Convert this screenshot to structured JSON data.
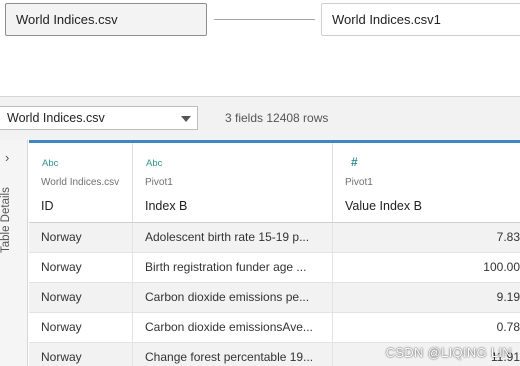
{
  "canvas": {
    "primary_table": "World Indices.csv",
    "secondary_table": "World Indices.csv1"
  },
  "toolbar": {
    "table_select_value": "World Indices.csv",
    "fields_info": "3 fields 12408 rows"
  },
  "rail": {
    "label": "Table Details"
  },
  "grid": {
    "columns": [
      {
        "type_label": "Abc",
        "source": "World Indices.csv",
        "name": "ID"
      },
      {
        "type_label": "Abc",
        "source": "Pivot1",
        "name": "Index B"
      },
      {
        "type_label": "#",
        "source": "Pivot1",
        "name": "Value Index B"
      }
    ],
    "rows": [
      [
        "Norway",
        "Adolescent birth rate 15-19 p...",
        "7.83"
      ],
      [
        "Norway",
        "Birth registration funder age ...",
        "100.00"
      ],
      [
        "Norway",
        "Carbon dioxide emissions pe...",
        "9.19"
      ],
      [
        "Norway",
        "Carbon dioxide emissionsAve...",
        "0.78"
      ],
      [
        "Norway",
        "Change forest percentable 19...",
        "11.91"
      ]
    ]
  },
  "watermark": "CSDN @LIQING LIN",
  "colors": {
    "accent_bar": "#3d88c0",
    "type_icon": "#2f8f8f",
    "row_shade": "#f2f2f2"
  }
}
